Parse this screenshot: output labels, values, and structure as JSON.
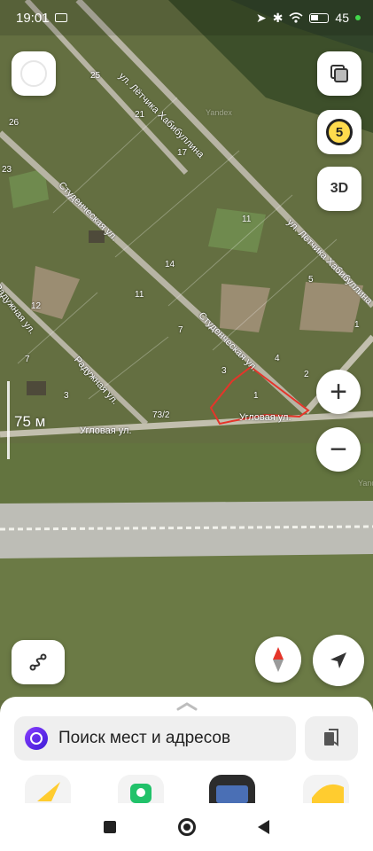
{
  "status_bar": {
    "time": "19:01",
    "battery": "45",
    "icons": [
      "location-arrow-icon",
      "bluetooth-icon",
      "wifi-icon",
      "battery-icon"
    ]
  },
  "map": {
    "streets": [
      {
        "name": "ул. Лётчика Хабибуллина"
      },
      {
        "name": "ул. Лётчика Хабибуллина"
      },
      {
        "name": "Студенческая ул."
      },
      {
        "name": "Студенческая ул."
      },
      {
        "name": "Радужная ул."
      },
      {
        "name": "Радужная ул."
      },
      {
        "name": "Угловая ул."
      },
      {
        "name": "Угловая ул."
      }
    ],
    "plot_numbers": [
      "25",
      "21",
      "26",
      "17",
      "23",
      "11",
      "5",
      "14",
      "12",
      "11",
      "7",
      "1",
      "7",
      "3",
      "4",
      "2",
      "3",
      "1",
      "73/2"
    ],
    "watermark": "Yandex",
    "scale_label": "75 м",
    "traffic_level": "5",
    "mode_3d_label": "3D",
    "zoom_in_label": "+",
    "zoom_out_label": "−"
  },
  "search": {
    "placeholder": "Поиск мест и адресов"
  },
  "colors": {
    "accent": "#ffdb4d",
    "outline": "#e5352a",
    "alice": "#6a2cf0"
  }
}
